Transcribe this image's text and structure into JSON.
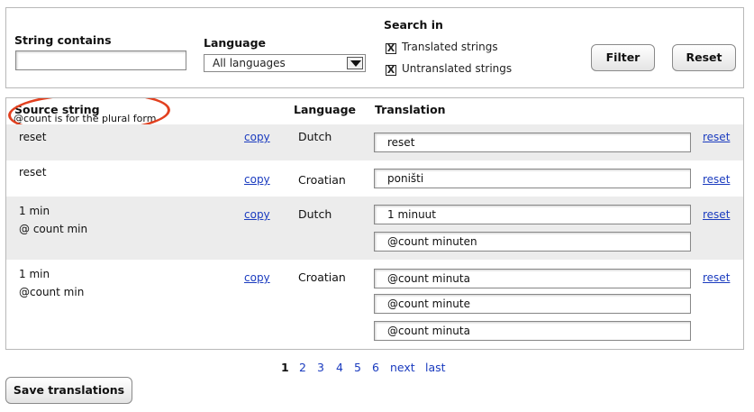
{
  "filters": {
    "string_contains_label": "String contains",
    "string_contains_value": "",
    "language_label": "Language",
    "language_selected": "All languages",
    "search_in_label": "Search in",
    "translated_label": "Translated strings",
    "translated_checked": "X",
    "untranslated_label": "Untranslated strings",
    "untranslated_checked": "X",
    "filter_button": "Filter",
    "reset_button": "Reset"
  },
  "table": {
    "headers": {
      "source": "Source string",
      "source_note": "@count is for the plural form",
      "language": "Language",
      "translation": "Translation"
    },
    "copy_label": "copy",
    "reset_label": "reset",
    "rows": [
      {
        "source": [
          "reset"
        ],
        "language": "Dutch",
        "translations": [
          "reset"
        ]
      },
      {
        "source": [
          "reset"
        ],
        "language": "Croatian",
        "translations": [
          "poništi"
        ]
      },
      {
        "source": [
          "1 min",
          "@ count min"
        ],
        "language": "Dutch",
        "translations": [
          "1 minuut",
          "@count minuten"
        ]
      },
      {
        "source": [
          "1 min",
          "@count min"
        ],
        "language": "Croatian",
        "translations": [
          "@count minuta",
          "@count minute",
          "@count minuta"
        ]
      }
    ]
  },
  "pager": {
    "current": "1",
    "pages": [
      "2",
      "3",
      "4",
      "5",
      "6"
    ],
    "next": "next",
    "last": "last"
  },
  "save_button": "Save translations",
  "annotation_color": "#e2401f"
}
